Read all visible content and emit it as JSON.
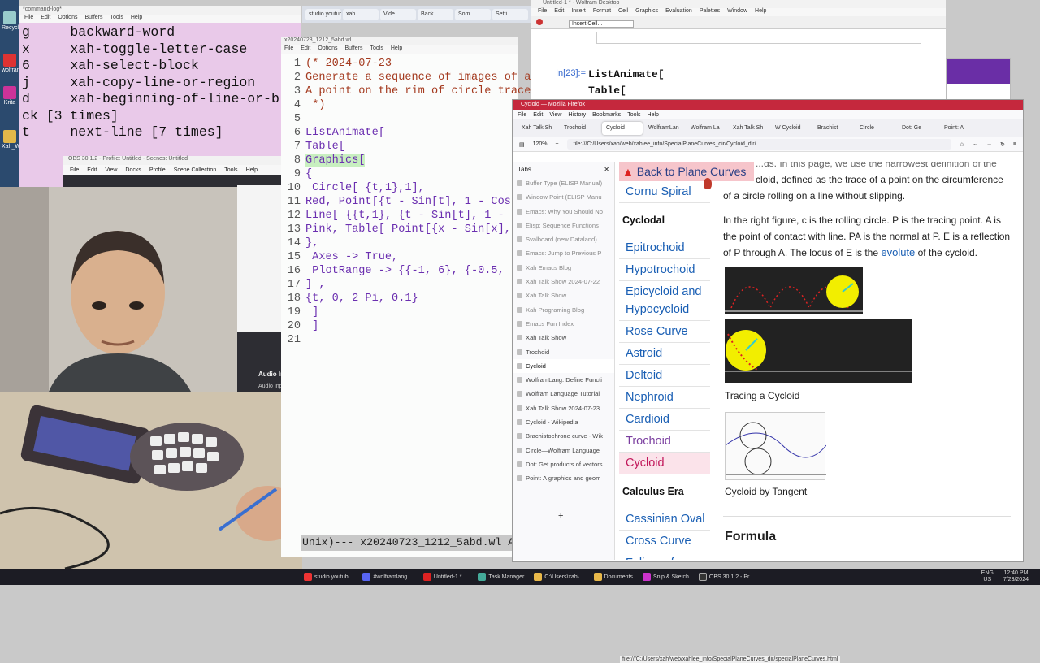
{
  "desktop": {
    "icons": [
      "Recycle",
      "wolfram",
      "Krita",
      "Xah_W..."
    ]
  },
  "cmdlog": {
    "title": "*command-log*",
    "menu": [
      "File",
      "Edit",
      "Options",
      "Buffers",
      "Tools",
      "Help"
    ],
    "lines": [
      "g     backward-word",
      "x     xah-toggle-letter-case",
      "6     xah-select-block",
      "j     xah-copy-line-or-region",
      "d     xah-beginning-of-line-or-blo",
      "ck [3 times]",
      "t     next-line [7 times]"
    ]
  },
  "obs": {
    "title": "OBS 30.1.2 - Profile: Untitled - Scenes: Untitled",
    "menu": [
      "File",
      "Edit",
      "View",
      "Docks",
      "Profile",
      "Scene Collection",
      "Tools",
      "Help"
    ],
    "audio_label": "Audio In",
    "audio_label2": "Audio Inp"
  },
  "code": {
    "title": "x20240723_1212_5abd.wl",
    "menu": [
      "File",
      "Edit",
      "Options",
      "Buffers",
      "Tools",
      "Help"
    ],
    "lines": [
      {
        "n": "1",
        "t": "(* 2024-07-23",
        "cls": "cc"
      },
      {
        "n": "2",
        "t": "Generate a sequence of images of a",
        "cls": "cc"
      },
      {
        "n": "3",
        "t": "A point on the rim of circle trace",
        "cls": "cc"
      },
      {
        "n": "4",
        "t": " *)",
        "cls": "cc"
      },
      {
        "n": "5",
        "t": "",
        "cls": ""
      },
      {
        "n": "6",
        "t": "ListAnimate[",
        "cls": "ct"
      },
      {
        "n": "7",
        "t": "Table[",
        "cls": "ct"
      },
      {
        "n": "8",
        "t": "Graphics[",
        "cls": "ct hl"
      },
      {
        "n": "9",
        "t": "{",
        "cls": "ct"
      },
      {
        "n": "10",
        "t": " Circle[ {t,1},1],",
        "cls": "ct"
      },
      {
        "n": "11",
        "t": "Red, Point[{t - Sin[t], 1 - Cos",
        "cls": "ct"
      },
      {
        "n": "12",
        "t": "Line[ {{t,1}, {t - Sin[t], 1 -",
        "cls": "ct"
      },
      {
        "n": "13",
        "t": "Pink, Table[ Point[{x - Sin[x],",
        "cls": "ct"
      },
      {
        "n": "14",
        "t": "},",
        "cls": "ct"
      },
      {
        "n": "15",
        "t": " Axes -> True,",
        "cls": "ct"
      },
      {
        "n": "16",
        "t": " PlotRange -> {{-1, 6}, {-0.5,",
        "cls": "ct"
      },
      {
        "n": "17",
        "t": "] ,",
        "cls": "ct"
      },
      {
        "n": "18",
        "t": "{t, 0, 2 Pi, 0.1}",
        "cls": "ct"
      },
      {
        "n": "19",
        "t": " ]",
        "cls": "ct"
      },
      {
        "n": "20",
        "t": " ]",
        "cls": "ct"
      },
      {
        "n": "21",
        "t": "",
        "cls": ""
      }
    ],
    "modeline": "Unix)--- x20240723_1212_5abd.wl  A"
  },
  "top_tabs": [
    "studio.youtub",
    "xah",
    "Vide",
    "Back",
    "Som",
    "Setti"
  ],
  "wolfram": {
    "title": "Untitled-1 * - Wolfram Desktop",
    "menu": [
      "File",
      "Edit",
      "Insert",
      "Format",
      "Cell",
      "Graphics",
      "Evaluation",
      "Palettes",
      "Window",
      "Help"
    ],
    "cell_style": "Insert Cell...",
    "in_label": "In[23]:=",
    "code1": "ListAnimate[",
    "code2": "  Table["
  },
  "firefox": {
    "title": "Cycloid — Mozilla Firefox",
    "menu": [
      "File",
      "Edit",
      "View",
      "History",
      "Bookmarks",
      "Tools",
      "Help"
    ],
    "tabs": [
      "Xah Talk Sh",
      "Trochoid",
      "Cycloid",
      "WolframLan",
      "Wolfram La",
      "Xah Talk Sh",
      "W Cycloid",
      "Brachist",
      "Circle—",
      "Dot: Ge",
      "Point: A"
    ],
    "zoom": "120%",
    "url": "file:///C:/Users/xah/web/xahlee_info/SpecialPlaneCurves_dir/Cycloid_dir/",
    "sidebar_title": "Tabs",
    "sidebar_tabs": [
      {
        "t": "Buffer Type (ELISP Manual)",
        "s": "dim"
      },
      {
        "t": "Window Point (ELISP Manu",
        "s": "dim"
      },
      {
        "t": "Emacs: Why You Should No",
        "s": "dim"
      },
      {
        "t": "Elisp: Sequence Functions",
        "s": "dim"
      },
      {
        "t": "Svalboard (new Dataland)",
        "s": "dim"
      },
      {
        "t": "Emacs: Jump to Previous P",
        "s": "dim"
      },
      {
        "t": "Xah Emacs Blog",
        "s": "dim"
      },
      {
        "t": "Xah Talk Show 2024-07-22",
        "s": "dim"
      },
      {
        "t": "Xah Talk Show",
        "s": "dim"
      },
      {
        "t": "Xah Programing Blog",
        "s": "dim"
      },
      {
        "t": "Emacs Fun Index",
        "s": "dim"
      },
      {
        "t": "Xah Talk Show",
        "s": ""
      },
      {
        "t": "Trochoid",
        "s": ""
      },
      {
        "t": "Cycloid",
        "s": "sel"
      },
      {
        "t": "WolframLang: Define Functi",
        "s": ""
      },
      {
        "t": "Wolfram Language Tutorial",
        "s": ""
      },
      {
        "t": "Xah Talk Show 2024-07-23",
        "s": ""
      },
      {
        "t": "Cycloid - Wikipedia",
        "s": ""
      },
      {
        "t": "Brachistochrone curve - Wik",
        "s": ""
      },
      {
        "t": "Circle—Wolfram Language",
        "s": ""
      },
      {
        "t": "Dot: Get products of vectors",
        "s": ""
      },
      {
        "t": "Point: A graphics and geom",
        "s": ""
      }
    ],
    "back_link": "Back to Plane Curves",
    "nav": {
      "first": "Cornu Spiral",
      "head1": "Cyclodal",
      "items1": [
        "Epitrochoid",
        "Hypotrochoid",
        "Epicycloid and Hypocycloid",
        "Rose Curve",
        "Astroid",
        "Deltoid",
        "Nephroid",
        "Cardioid",
        "Trochoid",
        "Cycloid"
      ],
      "head2": "Calculus Era",
      "items2": [
        "Cassinian Oval",
        "Cross Curve",
        "Folium of"
      ]
    },
    "content": {
      "p1a": "...ds. In this page, we use the narrowest definition of the",
      "p1b": "cloid, defined as the trace of a point on the circumference",
      "p1c": "of a circle rolling on a line without slipping.",
      "p2a": "In the right figure, c is the rolling circle. P is the tracing point. A is",
      "p2b": "the point of contact with line. PA is the normal at P. E is a reflection",
      "p2c_pre": "of P through A. The locus of E is the",
      "p2c_link": "evolute",
      "p2c_post": "of the cycloid.",
      "cap1": "Tracing a Cycloid",
      "cap2": "Cycloid by Tangent",
      "h2": "Formula"
    },
    "status": "file:///C:/Users/xah/web/xahlee_info/SpecialPlaneCurves_dir/specialPlaneCurves.html"
  },
  "taskbar": {
    "items": [
      "studio.youtub...",
      "#wolframlang ...",
      "Untitled-1 * ...",
      "Task Manager",
      "C:\\Users\\xah\\...",
      "Documents",
      "Snip & Sketch",
      "OBS 30.1.2 - Pr..."
    ],
    "lang": "ENG",
    "region": "US",
    "time": "12:40 PM",
    "date": "7/23/2024"
  },
  "colors": {
    "cmdlog_bg": "#e9c9e9",
    "comment": "#a43a1f",
    "keyword": "#6b2fb0",
    "firefox_red": "#c5283d",
    "link": "#1a5fb4"
  }
}
